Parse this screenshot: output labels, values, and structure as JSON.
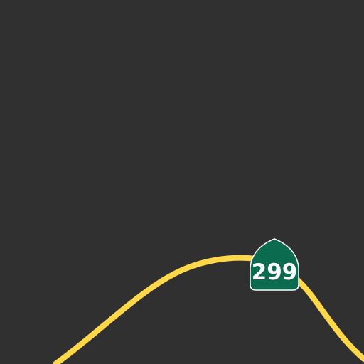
{
  "map": {
    "background_color": "#303030",
    "road": {
      "color": "#ffd84a",
      "route_number": "299",
      "shield": {
        "shape": "california-state-route-shield",
        "color": "#0b6b4f",
        "text_color": "#ffffff"
      }
    }
  }
}
